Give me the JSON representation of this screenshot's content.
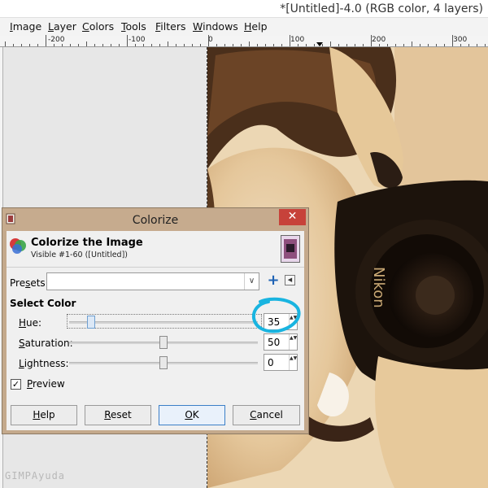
{
  "window": {
    "title": "*[Untitled]-4.0 (RGB color, 4 layers)"
  },
  "menubar": {
    "items": [
      {
        "label": "Image",
        "mnemonic": "I",
        "rest": "mage"
      },
      {
        "label": "Layer",
        "mnemonic": "L",
        "rest": "ayer"
      },
      {
        "label": "Colors",
        "mnemonic": "C",
        "rest": "olors"
      },
      {
        "label": "Tools",
        "mnemonic": "T",
        "rest": "ools"
      },
      {
        "label": "Filters",
        "mnemonic": "F",
        "rest": "ilters"
      },
      {
        "label": "Windows",
        "mnemonic": "W",
        "rest": "indows"
      },
      {
        "label": "Help",
        "mnemonic": "H",
        "rest": "elp"
      }
    ]
  },
  "ruler": {
    "labels": [
      "-200",
      "-100",
      "0",
      "100",
      "200",
      "300"
    ]
  },
  "watermark": "GIMPAyuda",
  "dialog": {
    "window_title": "Colorize",
    "close_glyph": "✕",
    "header_title": "Colorize the Image",
    "header_subtitle": "Visible #1-60 ([Untitled])",
    "presets": {
      "label_pre": "Pre",
      "label_mn": "s",
      "label_post": "ets:",
      "value": "",
      "dropdown_glyph": "∨",
      "add_glyph": "+",
      "menu_glyph": "◀"
    },
    "section_label": "Select Color",
    "controls": {
      "hue": {
        "mnemonic": "H",
        "rest": "ue:",
        "value": "35",
        "fraction": 0.097
      },
      "saturation": {
        "mnemonic": "S",
        "rest": "aturation:",
        "value": "50",
        "fraction": 0.5
      },
      "lightness": {
        "mnemonic": "L",
        "rest": "ightness:",
        "value": "0",
        "fraction": 0.5
      }
    },
    "preview": {
      "mnemonic": "P",
      "rest": "review",
      "checked": true,
      "glyph": "✓"
    },
    "buttons": {
      "help": {
        "mnemonic": "H",
        "rest": "elp"
      },
      "reset": {
        "mnemonic": "R",
        "rest": "eset"
      },
      "ok": {
        "mnemonic": "O",
        "rest": "K"
      },
      "cancel": {
        "mnemonic": "C",
        "rest": "ancel"
      }
    },
    "spin_arrows": "▲▼"
  },
  "colors": {
    "annotation_circle": "#19b4e0",
    "close_button": "#c7423a",
    "dialog_frame": "#c4a98c"
  }
}
